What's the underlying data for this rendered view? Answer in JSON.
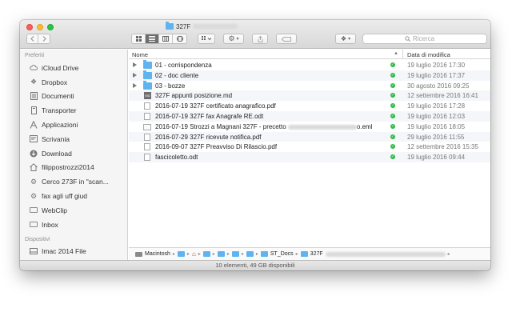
{
  "window": {
    "title": "327F",
    "search_placeholder": "Ricerca"
  },
  "toolbar": {
    "back_icon": "chevron-left-icon",
    "forward_icon": "chevron-right-icon"
  },
  "sidebar": {
    "favorites_header": "Preferiti",
    "favorites": [
      {
        "label": "iCloud Drive",
        "icon": "cloud-icon"
      },
      {
        "label": "Dropbox",
        "icon": "dropbox-icon"
      },
      {
        "label": "Documenti",
        "icon": "documents-icon"
      },
      {
        "label": "Transporter",
        "icon": "transporter-icon"
      },
      {
        "label": "Applicazioni",
        "icon": "applications-icon"
      },
      {
        "label": "Scrivania",
        "icon": "desktop-icon"
      },
      {
        "label": "Download",
        "icon": "download-icon"
      },
      {
        "label": "filippostrozzi2014",
        "icon": "home-icon"
      },
      {
        "label": "Cerco 273F in \"scan...",
        "icon": "gear-icon"
      },
      {
        "label": "fax agli uff giud",
        "icon": "gear-icon"
      },
      {
        "label": "WebClip",
        "icon": "folder-icon"
      },
      {
        "label": "Inbox",
        "icon": "folder-icon"
      }
    ],
    "devices_header": "Dispositivi",
    "devices": [
      {
        "label": "Imac 2014 File",
        "icon": "disk-icon"
      }
    ]
  },
  "columns": {
    "name": "Nome",
    "date": "Data di modifica"
  },
  "files": [
    {
      "name": "01 - corrispondenza",
      "date": "19 luglio 2016 17:30",
      "kind": "folder"
    },
    {
      "name": "02 - doc cliente",
      "date": "19 luglio 2016 17:37",
      "kind": "folder"
    },
    {
      "name": "03 - bozze",
      "date": "30 agosto 2016 09:25",
      "kind": "folder"
    },
    {
      "name": "327F appunti posizione.md",
      "date": "12 settembre 2016 16:41",
      "kind": "md"
    },
    {
      "name": "2016-07-19 327F certificato anagrafico.pdf",
      "date": "19 luglio 2016 17:28",
      "kind": "doc"
    },
    {
      "name": "2016-07-19 327F fax Anagrafe RE.odt",
      "date": "19 luglio 2016 12:03",
      "kind": "doc"
    },
    {
      "name": "2016-07-19 Strozzi a Magnani 327F - precetto",
      "name_suffix": "o.eml",
      "date": "19 luglio 2016 18:05",
      "kind": "mail"
    },
    {
      "name": "2016-07-29 327F ricevute notifica.pdf",
      "date": "29 luglio 2016 11:55",
      "kind": "doc"
    },
    {
      "name": "2016-09-07 327F Preavviso Di Rilascio.pdf",
      "date": "12 settembre 2016 15:35",
      "kind": "doc"
    },
    {
      "name": "fascicoletto.odt",
      "date": "19 luglio 2016 09:44",
      "kind": "doc"
    }
  ],
  "pathbar": {
    "disk": "Macintosh",
    "st_docs": "ST_Docs",
    "current": "327F"
  },
  "status": "10 elementi, 49 GB disponibili"
}
